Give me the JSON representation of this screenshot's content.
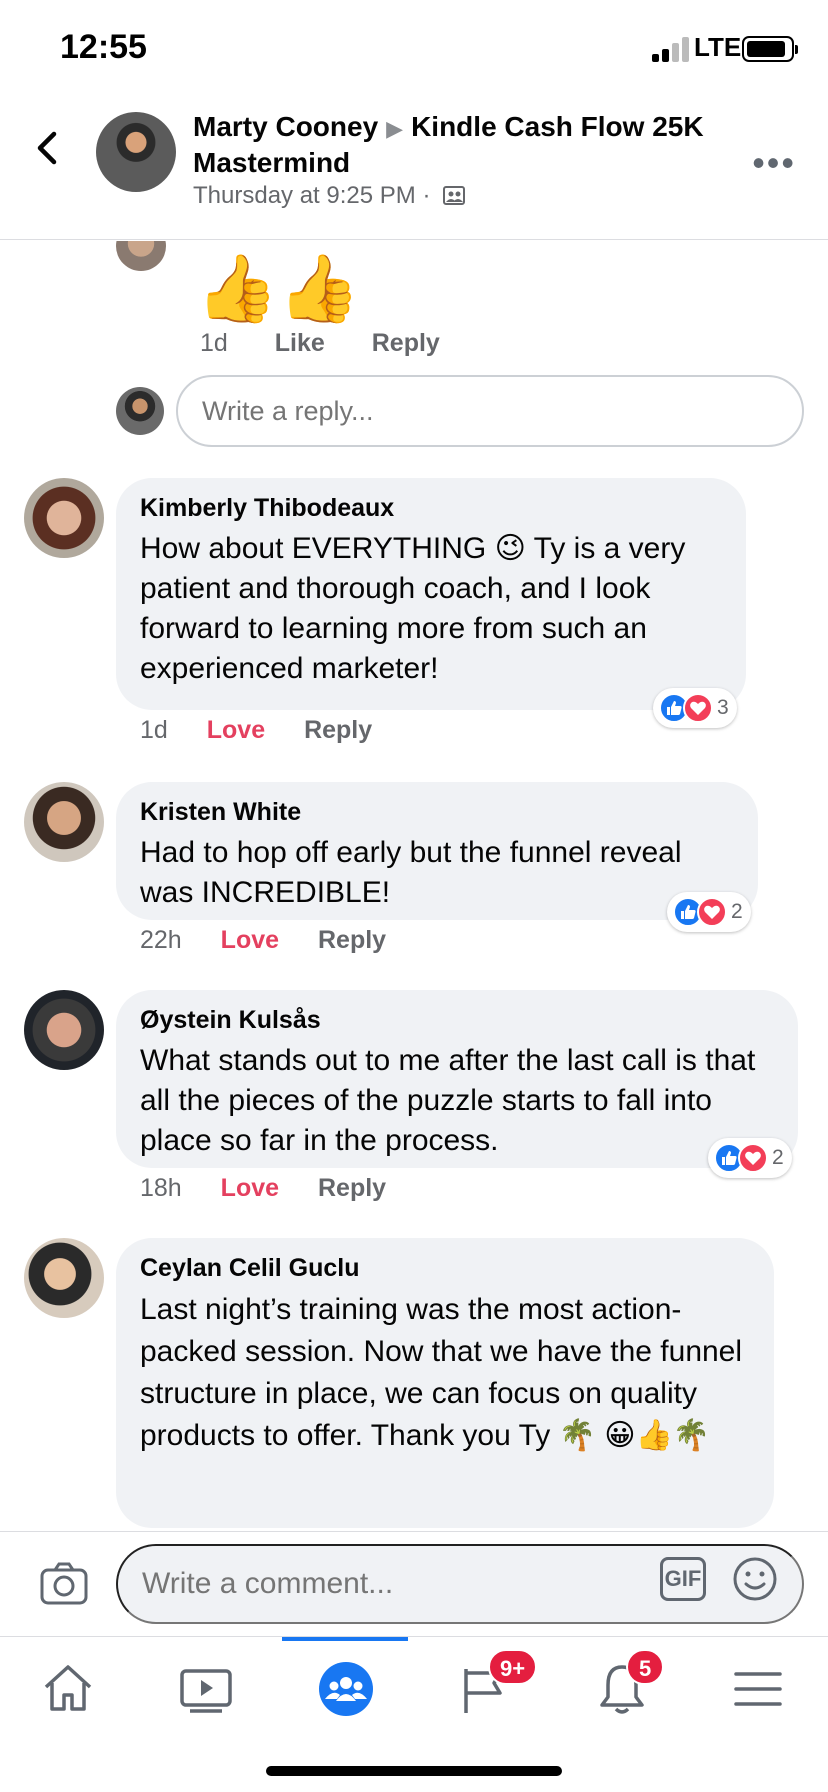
{
  "status": {
    "time": "12:55",
    "network": "LTE"
  },
  "header": {
    "author": "Marty Cooney",
    "group": "Kindle Cash Flow 25K Mastermind",
    "timestamp": "Thursday at 9:25 PM ·",
    "more": "•••"
  },
  "top_reply": {
    "emoji": "👍👍",
    "time": "1d",
    "like": "Like",
    "reply": "Reply",
    "reply_placeholder": "Write a reply..."
  },
  "comments": [
    {
      "name": "Kimberly Thibodeaux",
      "text": "How about EVERYTHING 😉 Ty is a very patient and thorough coach, and I look forward to learning more from such an experienced marketer!",
      "time": "1d",
      "love": "Love",
      "reply": "Reply",
      "reactions": "3"
    },
    {
      "name": "Kristen White",
      "text": "Had to hop off early but the funnel reveal was INCREDIBLE!",
      "time": "22h",
      "love": "Love",
      "reply": "Reply",
      "reactions": "2"
    },
    {
      "name": "Øystein Kulsås",
      "text": "What stands out to me after the last call is that all the pieces of the puzzle starts to fall into place so far in the process.",
      "time": "18h",
      "love": "Love",
      "reply": "Reply",
      "reactions": "2"
    },
    {
      "name": "Ceylan Celil Guclu",
      "text": "Last night’s training was the most action-packed session. Now that we have the funnel structure in place, we can focus on quality products to offer. Thank you Ty 🌴 😀👍🌴"
    }
  ],
  "composer": {
    "placeholder": "Write a comment...",
    "gif": "GIF"
  },
  "tabbar": {
    "notifications_flag_badge": "9+",
    "notifications_badge": "5",
    "active": "groups"
  },
  "colors": {
    "accent": "#1877f2",
    "love": "#e4405f",
    "badge": "#e41e3f",
    "bubble": "#f0f2f5"
  }
}
